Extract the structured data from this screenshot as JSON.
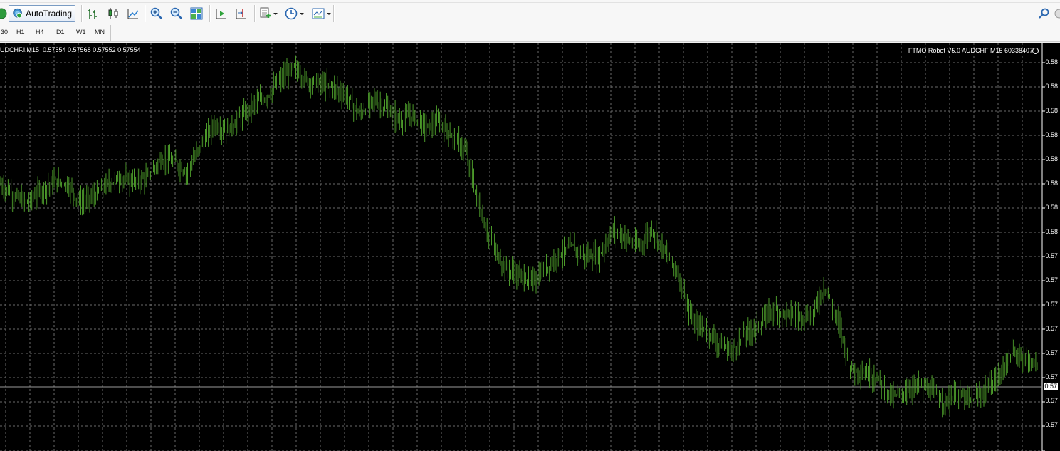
{
  "toolbar": {
    "autotrading_label": "AutoTrading",
    "icons": [
      "refresh-icon",
      "autotrading-icon",
      "bar-chart-icon",
      "candlestick-icon",
      "line-chart-icon",
      "zoom-in-icon",
      "zoom-out-icon",
      "tile-windows-icon",
      "autoscroll-icon",
      "chart-shift-icon",
      "indicators-icon",
      "periods-icon",
      "templates-icon",
      "search-icon"
    ]
  },
  "timeframes": [
    "30",
    "H1",
    "H4",
    "D1",
    "W1",
    "MN"
  ],
  "chart": {
    "header_left": "UDCHF.i,M15  0.57554 0.57568 0.57552 0.57554",
    "header_right": "FTMO Robot V5.0 AUDCHF M15 60338407",
    "bar_color": "#4c9a2a",
    "grid_color": "#6a6a6a",
    "background": "#000000",
    "price_labels": [
      "0.58",
      "0.58",
      "0.58",
      "0.58",
      "0.58",
      "0.58",
      "0.58",
      "0.58",
      "0.57",
      "0.57",
      "0.57",
      "0.57",
      "0.57",
      "0.57",
      "0.57",
      "0.57"
    ],
    "current_price": "0.57"
  },
  "chart_data": {
    "type": "line",
    "title": "",
    "series": [
      {
        "values": [
          0.581,
          0.5806,
          0.5804,
          0.5808,
          0.5811,
          0.581,
          0.5804,
          0.5806,
          0.581,
          0.5812,
          0.5811,
          0.5812,
          0.5818,
          0.5817,
          0.5814,
          0.5822,
          0.5829,
          0.5827,
          0.5831,
          0.5835,
          0.5838,
          0.5843,
          0.5847,
          0.5843,
          0.5842,
          0.5841,
          0.5838,
          0.5832,
          0.5837,
          0.5834,
          0.583,
          0.5832,
          0.5828,
          0.583,
          0.5825,
          0.582,
          0.5802,
          0.579,
          0.5783,
          0.5781,
          0.5779,
          0.5783,
          0.5788,
          0.579,
          0.5787,
          0.5787,
          0.5795,
          0.5793,
          0.579,
          0.5796,
          0.5788,
          0.5781,
          0.5766,
          0.5764,
          0.5759,
          0.5757,
          0.5762,
          0.5765,
          0.577,
          0.5769,
          0.5768,
          0.5768,
          0.5778,
          0.5766,
          0.5751,
          0.575,
          0.5748,
          0.5742,
          0.5744,
          0.5746,
          0.5744,
          0.5741,
          0.5743,
          0.5741,
          0.5744,
          0.5748,
          0.5756,
          0.5755,
          0.5752
        ]
      }
    ]
  }
}
